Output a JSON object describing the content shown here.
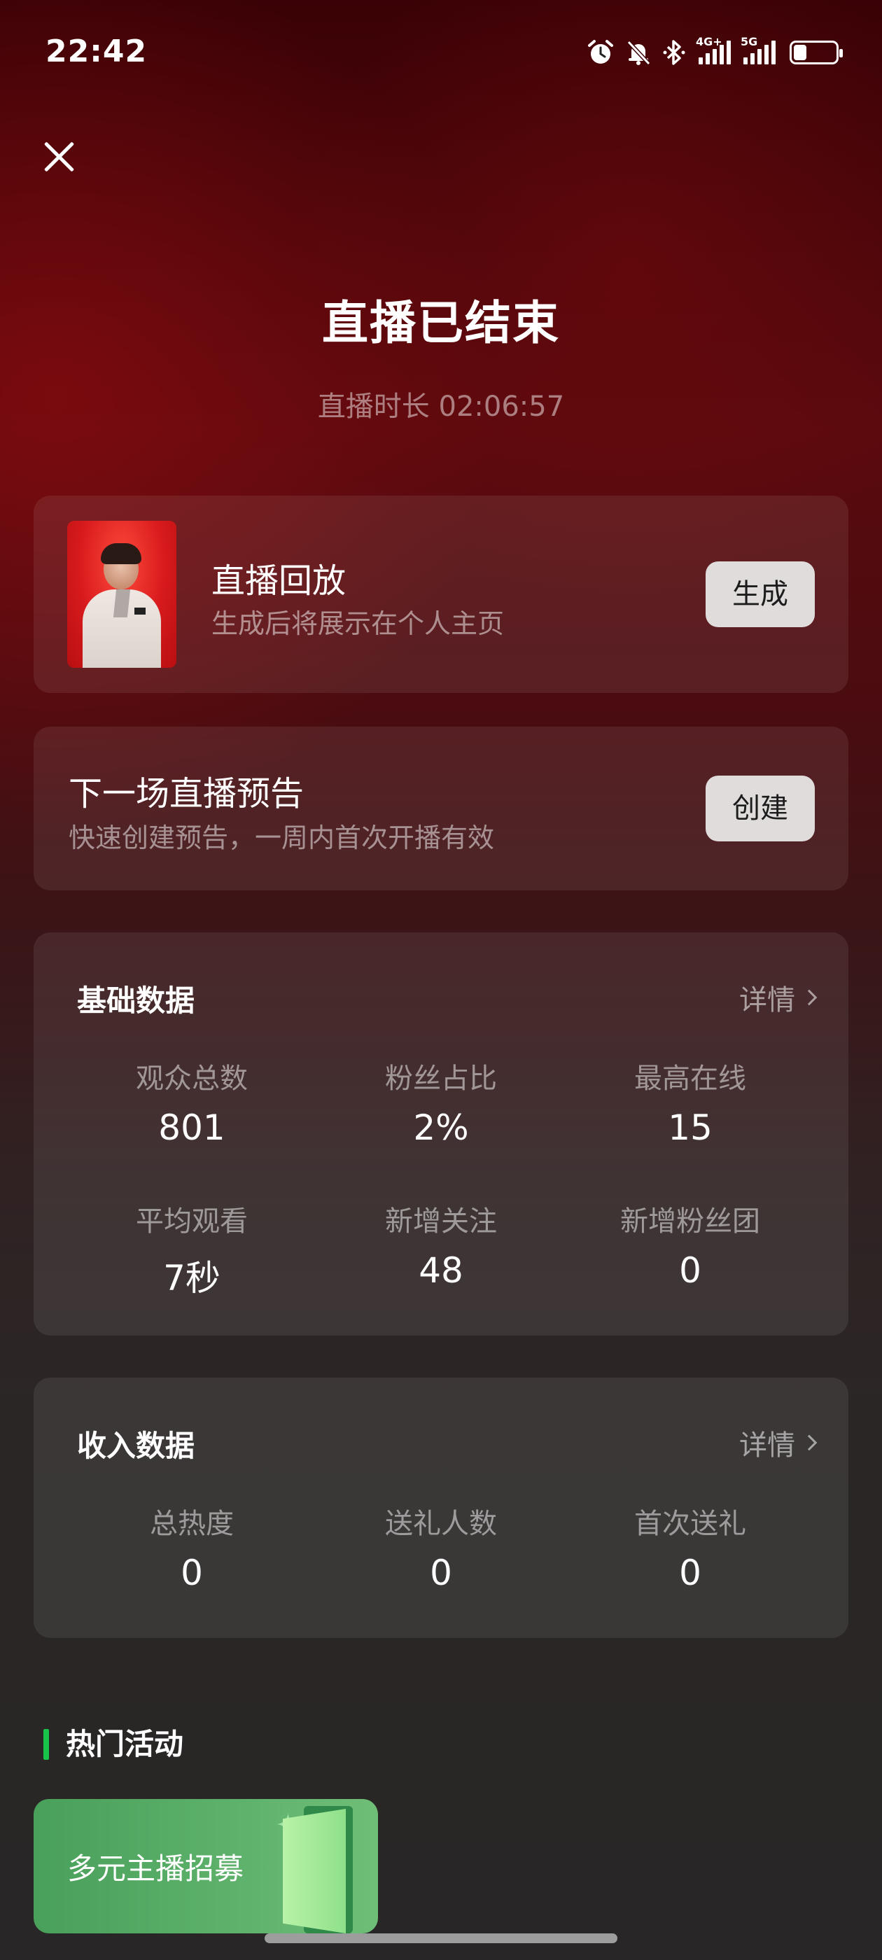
{
  "status_bar": {
    "time": "22:42",
    "net1": "4G+",
    "net2": "5G",
    "icons": [
      "alarm-icon",
      "mute-bell-icon",
      "bluetooth-icon",
      "signal-4g-icon",
      "signal-5g-icon",
      "battery-icon"
    ]
  },
  "header": {
    "title": "直播已结束",
    "duration": "直播时长 02:06:57"
  },
  "replay": {
    "title": "直播回放",
    "subtitle": "生成后将展示在个人主页",
    "button": "生成"
  },
  "preview": {
    "title": "下一场直播预告",
    "subtitle": "快速创建预告，一周内首次开播有效",
    "button": "创建"
  },
  "basic_stats": {
    "title": "基础数据",
    "detail": "详情",
    "items": [
      {
        "label": "观众总数",
        "value": "801"
      },
      {
        "label": "粉丝占比",
        "value": "2%"
      },
      {
        "label": "最高在线",
        "value": "15"
      },
      {
        "label": "平均观看",
        "value": "7秒"
      },
      {
        "label": "新增关注",
        "value": "48"
      },
      {
        "label": "新增粉丝团",
        "value": "0"
      }
    ]
  },
  "income_stats": {
    "title": "收入数据",
    "detail": "详情",
    "items": [
      {
        "label": "总热度",
        "value": "0"
      },
      {
        "label": "送礼人数",
        "value": "0"
      },
      {
        "label": "首次送礼",
        "value": "0"
      }
    ]
  },
  "hot": {
    "title": "热门活动",
    "activities": [
      {
        "label": "多元主播招募"
      }
    ]
  },
  "colors": {
    "accent_green": "#19c24a",
    "button_bg": "#e1dcdc",
    "background_top": "#3a0206",
    "background_bottom": "#282626"
  }
}
